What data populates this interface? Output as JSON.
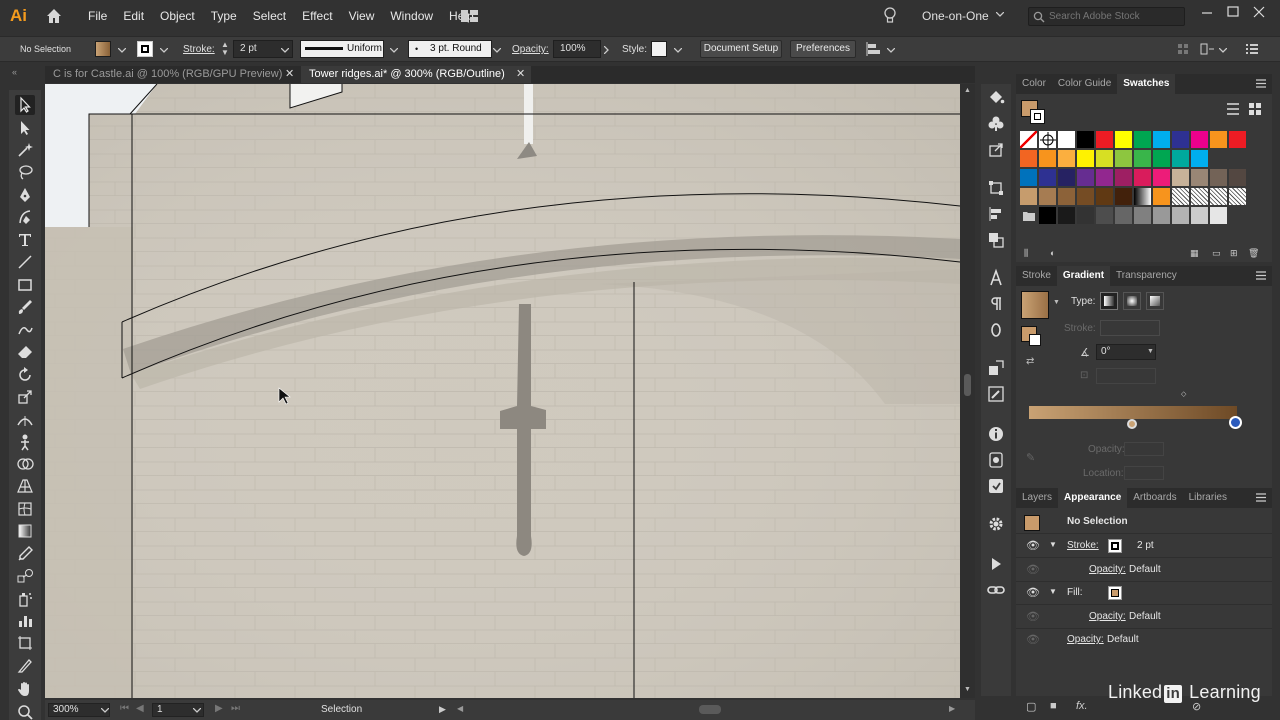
{
  "app": {
    "logo": "Ai",
    "workspace": "One-on-One",
    "stock_search_placeholder": "Search Adobe Stock"
  },
  "menu": [
    "File",
    "Edit",
    "Object",
    "Type",
    "Select",
    "Effect",
    "View",
    "Window",
    "Help"
  ],
  "control": {
    "selection": "No Selection",
    "stroke_label": "Stroke:",
    "stroke_weight": "2 pt",
    "profile": "Uniform",
    "brush": "3 pt. Round",
    "opacity_label": "Opacity:",
    "opacity": "100%",
    "style_label": "Style:",
    "doc_setup": "Document Setup",
    "preferences": "Preferences"
  },
  "tabs": [
    {
      "label": "C is for Castle.ai @ 100% (RGB/GPU Preview)",
      "active": false
    },
    {
      "label": "Tower ridges.ai* @ 300% (RGB/Outline)",
      "active": true
    }
  ],
  "status": {
    "zoom": "300%",
    "artboard": "1",
    "tool": "Selection"
  },
  "swatches_panel": {
    "tabs": [
      "Color",
      "Color Guide",
      "Swatches"
    ],
    "active": "Swatches",
    "colors": [
      [
        "none",
        "registration",
        "#ffffff",
        "#000000",
        "#ed1c24",
        "#ffff00",
        "#00a651",
        "#00aeef",
        "#2e3192",
        "#ec008c",
        "#f7941d",
        "#ed1c24"
      ],
      [
        "#f26522",
        "#f7941d",
        "#fbaf3f",
        "#fff200",
        "#d7df23",
        "#8dc63f",
        "#39b54a",
        "#00a651",
        "#00a99d",
        "#00aeef"
      ],
      [
        "#0072bc",
        "#2e3192",
        "#262262",
        "#662d91",
        "#92278f",
        "#9e1f63",
        "#d91c5c",
        "#ed1c79",
        "#c7b299",
        "#998675",
        "#736357",
        "#534741"
      ],
      [
        "#c69c6d",
        "#a67c52",
        "#8c6239",
        "#754c24",
        "#603913",
        "#42210b",
        "gradient-bw",
        "#f7941d",
        "pattern",
        "pattern",
        "pattern",
        "pattern"
      ],
      [
        "folder",
        "#000000",
        "#1a1a1a",
        "#333333",
        "#4d4d4d",
        "#666666",
        "#808080",
        "#999999",
        "#b3b3b3",
        "#cccccc",
        "#e6e6e6"
      ]
    ]
  },
  "gradient_panel": {
    "tabs": [
      "Stroke",
      "Gradient",
      "Transparency"
    ],
    "active": "Gradient",
    "type_label": "Type:",
    "stroke_label": "Stroke:",
    "angle": "0°",
    "opacity_label": "Opacity:",
    "location_label": "Location:",
    "start_color": "#c9a274",
    "end_color": "#6e4a26"
  },
  "appearance_panel": {
    "tabs": [
      "Layers",
      "Appearance",
      "Artboards",
      "Libraries"
    ],
    "active": "Appearance",
    "title": "No Selection",
    "rows": [
      {
        "label": "Stroke:",
        "value": "2 pt"
      },
      {
        "label": "Opacity:",
        "value": "Default"
      },
      {
        "label": "Fill:",
        "value": ""
      },
      {
        "label": "Opacity:",
        "value": "Default"
      },
      {
        "label": "Opacity:",
        "value": "Default"
      }
    ]
  },
  "colors": {
    "accent_fill": "#c99b6b",
    "ai_orange": "#f49b1e"
  },
  "branding": {
    "left": "Linked",
    "in": "in",
    "right": " Learning"
  }
}
